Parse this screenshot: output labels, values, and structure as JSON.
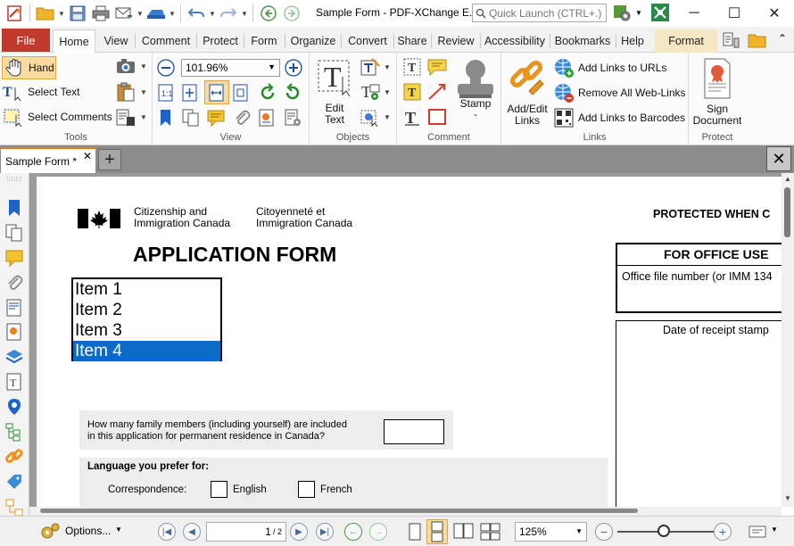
{
  "titlebar": {
    "document_title": "Sample Form - PDF-XChange E..",
    "quick_launch_placeholder": "Quick Launch (CTRL+.)"
  },
  "ribbon_tabs": [
    "File",
    "Home",
    "View",
    "Comment",
    "Protect",
    "Form",
    "Organize",
    "Convert",
    "Share",
    "Review",
    "Accessibility",
    "Bookmarks",
    "Help",
    "Format"
  ],
  "ribbon": {
    "tools": {
      "label": "Tools",
      "hand": "Hand",
      "select_text": "Select Text",
      "select_comments": "Select Comments"
    },
    "view": {
      "label": "View",
      "zoom": "101.96%"
    },
    "objects": {
      "label": "Objects",
      "edit_text": "Edit\nText",
      "edit_text_l1": "Edit",
      "edit_text_l2": "Text"
    },
    "comment": {
      "label": "Comment",
      "stamp": "Stamp"
    },
    "links": {
      "label": "Links",
      "add_edit_l1": "Add/Edit",
      "add_edit_l2": "Links",
      "add_links_to_urls": "Add Links to URLs",
      "remove_all_web_links": "Remove All Web-Links",
      "add_links_to_barcodes": "Add Links to Barcodes"
    },
    "protect": {
      "label": "Protect",
      "sign_l1": "Sign",
      "sign_l2": "Document"
    }
  },
  "document_tabs": {
    "active": "Sample Form *"
  },
  "page": {
    "dept_en_l1": "Citizenship and",
    "dept_en_l2": "Immigration Canada",
    "dept_fr_l1": "Citoyenneté et",
    "dept_fr_l2": "Immigration Canada",
    "protected": "PROTECTED WHEN C",
    "heading": "APPLICATION FORM",
    "listbox_items": [
      "Item 1",
      "Item 2",
      "Item 3",
      "Item 4"
    ],
    "selected_item": "Item 4",
    "office_use": "FOR OFFICE USE",
    "office_file": "Office file number (or IMM 134",
    "receipt": "Date of receipt stamp",
    "question_l1": "How many family members (including yourself) are included",
    "question_l2": "in this application for permanent residence in Canada?",
    "language_title": "Language you prefer for:",
    "correspondence": "Correspondence:",
    "english": "English",
    "french": "French"
  },
  "statusbar": {
    "options": "Options...",
    "page_current": "1",
    "page_total": "/ 2",
    "zoom": "125%"
  },
  "colors": {
    "file_tab": "#c0392b",
    "format_tab": "#f5e6c4",
    "selection": "#0b6bc7",
    "active_tab_accent": "#e07a1f"
  }
}
